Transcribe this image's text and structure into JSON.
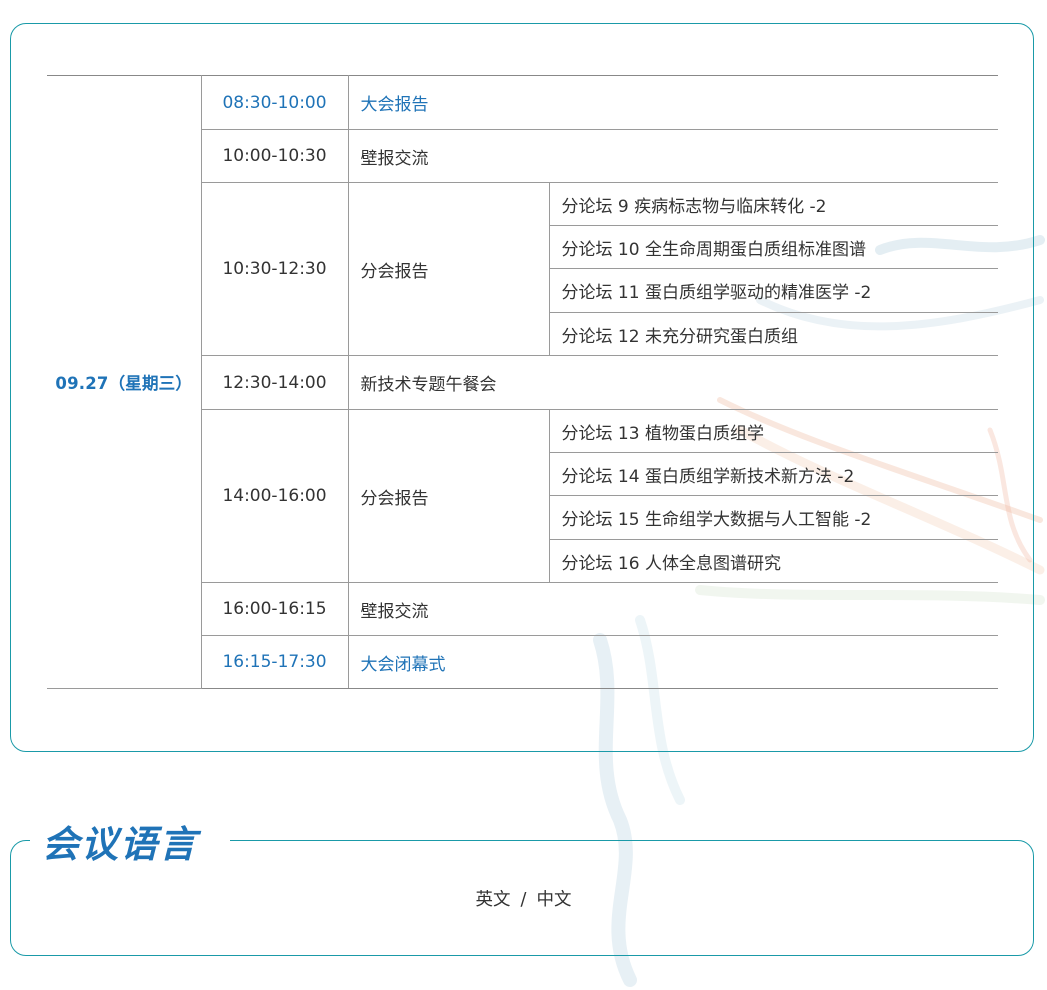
{
  "schedule": {
    "day": "09.27（星期三）",
    "rows": [
      {
        "time": "08:30-10:00",
        "activity": "大会报告",
        "highlight": true
      },
      {
        "time": "10:00-10:30",
        "activity": "壁报交流"
      },
      {
        "time": "10:30-12:30",
        "activity": "分会报告",
        "forums": [
          "分论坛 9 疾病标志物与临床转化 -2",
          "分论坛 10 全生命周期蛋白质组标准图谱",
          "分论坛 11 蛋白质组学驱动的精准医学 -2",
          "分论坛 12 未充分研究蛋白质组"
        ]
      },
      {
        "time": "12:30-14:00",
        "activity": "新技术专题午餐会"
      },
      {
        "time": "14:00-16:00",
        "activity": "分会报告",
        "forums": [
          "分论坛 13 植物蛋白质组学",
          "分论坛 14 蛋白质组学新技术新方法 -2",
          "分论坛 15 生命组学大数据与人工智能 -2",
          "分论坛 16 人体全息图谱研究"
        ]
      },
      {
        "time": "16:00-16:15",
        "activity": "壁报交流"
      },
      {
        "time": "16:15-17:30",
        "activity": "大会闭幕式",
        "highlight": true
      }
    ]
  },
  "language_section": {
    "title": "会议语言",
    "lang_1": "英文",
    "separator": "/",
    "lang_2": "中文"
  },
  "colors": {
    "accent_blue": "#1f73b7",
    "border_teal": "#1a9aa8",
    "text": "#333333"
  }
}
